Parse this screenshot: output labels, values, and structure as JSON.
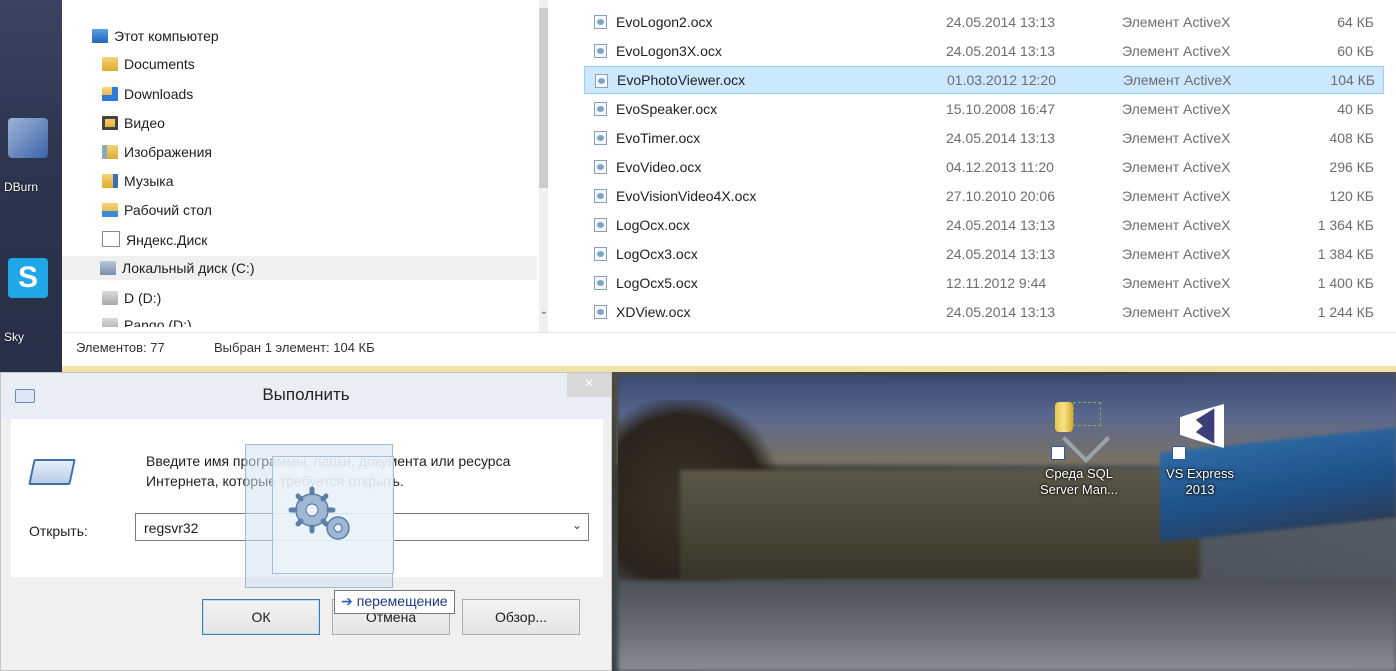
{
  "explorer": {
    "nav": [
      {
        "label": "Этот компьютер",
        "icon": "computer-icon"
      },
      {
        "label": "Documents",
        "icon": "folder-icon"
      },
      {
        "label": "Downloads",
        "icon": "downloads-folder-icon"
      },
      {
        "label": "Видео",
        "icon": "video-folder-icon"
      },
      {
        "label": "Изображения",
        "icon": "pictures-folder-icon"
      },
      {
        "label": "Музыка",
        "icon": "music-folder-icon"
      },
      {
        "label": "Рабочий стол",
        "icon": "desktop-folder-icon"
      },
      {
        "label": "Яндекс.Диск",
        "icon": "yandex-disk-icon"
      },
      {
        "label": "Локальный диск (C:)",
        "icon": "local-disk-icon"
      },
      {
        "label": "D (D:)",
        "icon": "drive-icon"
      },
      {
        "label": "Pango (D:)",
        "icon": "drive-icon"
      }
    ],
    "files": [
      {
        "name": "EvoLogon2.ocx",
        "date": "24.05.2014 13:13",
        "type": "Элемент ActiveX",
        "size": "64 КБ"
      },
      {
        "name": "EvoLogon3X.ocx",
        "date": "24.05.2014 13:13",
        "type": "Элемент ActiveX",
        "size": "60 КБ"
      },
      {
        "name": "EvoPhotoViewer.ocx",
        "date": "01.03.2012 12:20",
        "type": "Элемент ActiveX",
        "size": "104 КБ",
        "selected": true
      },
      {
        "name": "EvoSpeaker.ocx",
        "date": "15.10.2008 16:47",
        "type": "Элемент ActiveX",
        "size": "40 КБ"
      },
      {
        "name": "EvoTimer.ocx",
        "date": "24.05.2014 13:13",
        "type": "Элемент ActiveX",
        "size": "408 КБ"
      },
      {
        "name": "EvoVideo.ocx",
        "date": "04.12.2013 11:20",
        "type": "Элемент ActiveX",
        "size": "296 КБ"
      },
      {
        "name": "EvoVisionVideo4X.ocx",
        "date": "27.10.2010 20:06",
        "type": "Элемент ActiveX",
        "size": "120 КБ"
      },
      {
        "name": "LogOcx.ocx",
        "date": "24.05.2014 13:13",
        "type": "Элемент ActiveX",
        "size": "1 364 КБ"
      },
      {
        "name": "LogOcx3.ocx",
        "date": "24.05.2014 13:13",
        "type": "Элемент ActiveX",
        "size": "1 384 КБ"
      },
      {
        "name": "LogOcx5.ocx",
        "date": "12.11.2012 9:44",
        "type": "Элемент ActiveX",
        "size": "1 400 КБ"
      },
      {
        "name": "XDView.ocx",
        "date": "24.05.2014 13:13",
        "type": "Элемент ActiveX",
        "size": "1 244 КБ"
      }
    ],
    "status": {
      "count": "Элементов: 77",
      "selection": "Выбран 1 элемент: 104 КБ"
    }
  },
  "desktop": {
    "left_labels": {
      "dburn": "DBurn",
      "skype": "Sky"
    },
    "icons": [
      {
        "label_line1": "Среда SQL",
        "label_line2": "Server Man...",
        "icon": "sql-server-management-studio-icon"
      },
      {
        "label_line1": "VS Express",
        "label_line2": "2013",
        "icon": "visual-studio-icon"
      }
    ]
  },
  "run_dialog": {
    "title": "Выполнить",
    "close": "×",
    "prompt_line1": "Введите имя программы, папки, документа или ресурса",
    "prompt_line2": "Интернета, которые требуется открыть.",
    "open_label": "Открыть:",
    "open_value": "regsvr32",
    "ok": "ОК",
    "cancel": "Отмена",
    "browse": "Обзор..."
  },
  "drag": {
    "tooltip": "перемещение",
    "icon": "gear-icon"
  },
  "colors": {
    "selection_fill": "#cce8ff",
    "selection_border": "#99d1ff",
    "status_strip": "#f1e2a8",
    "tooltip_text": "#1f3a8a"
  }
}
